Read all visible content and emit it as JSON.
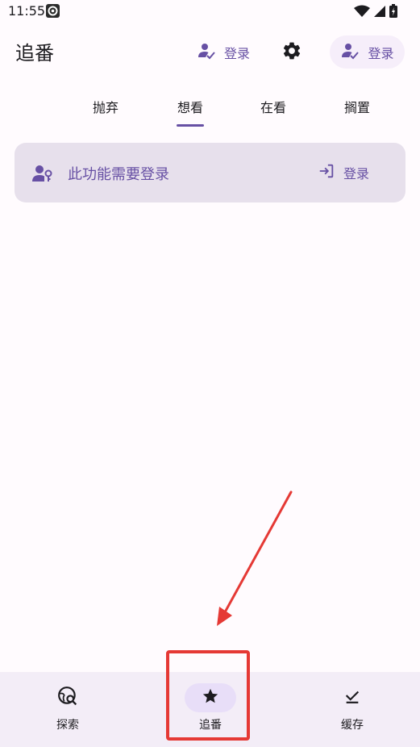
{
  "status_bar": {
    "time": "11:55"
  },
  "app_bar": {
    "title": "追番",
    "login_text_button": "登录",
    "tonal_login_button": "登录"
  },
  "tabs": [
    {
      "label": "抛弃",
      "active": false
    },
    {
      "label": "想看",
      "active": true
    },
    {
      "label": "在看",
      "active": false
    },
    {
      "label": "搁置",
      "active": false
    }
  ],
  "login_card": {
    "message": "此功能需要登录",
    "action_label": "登录"
  },
  "bottom_nav": [
    {
      "label": "探索",
      "icon": "travel-explore-icon",
      "active": false
    },
    {
      "label": "追番",
      "icon": "star-icon",
      "active": true
    },
    {
      "label": "缓存",
      "icon": "download-done-icon",
      "active": false
    }
  ],
  "colors": {
    "primary": "#6750a4",
    "card_background": "#e7e0ec",
    "nav_background": "#f3edf7",
    "nav_active_pill": "#e8def8",
    "annotation": "#e53935"
  }
}
